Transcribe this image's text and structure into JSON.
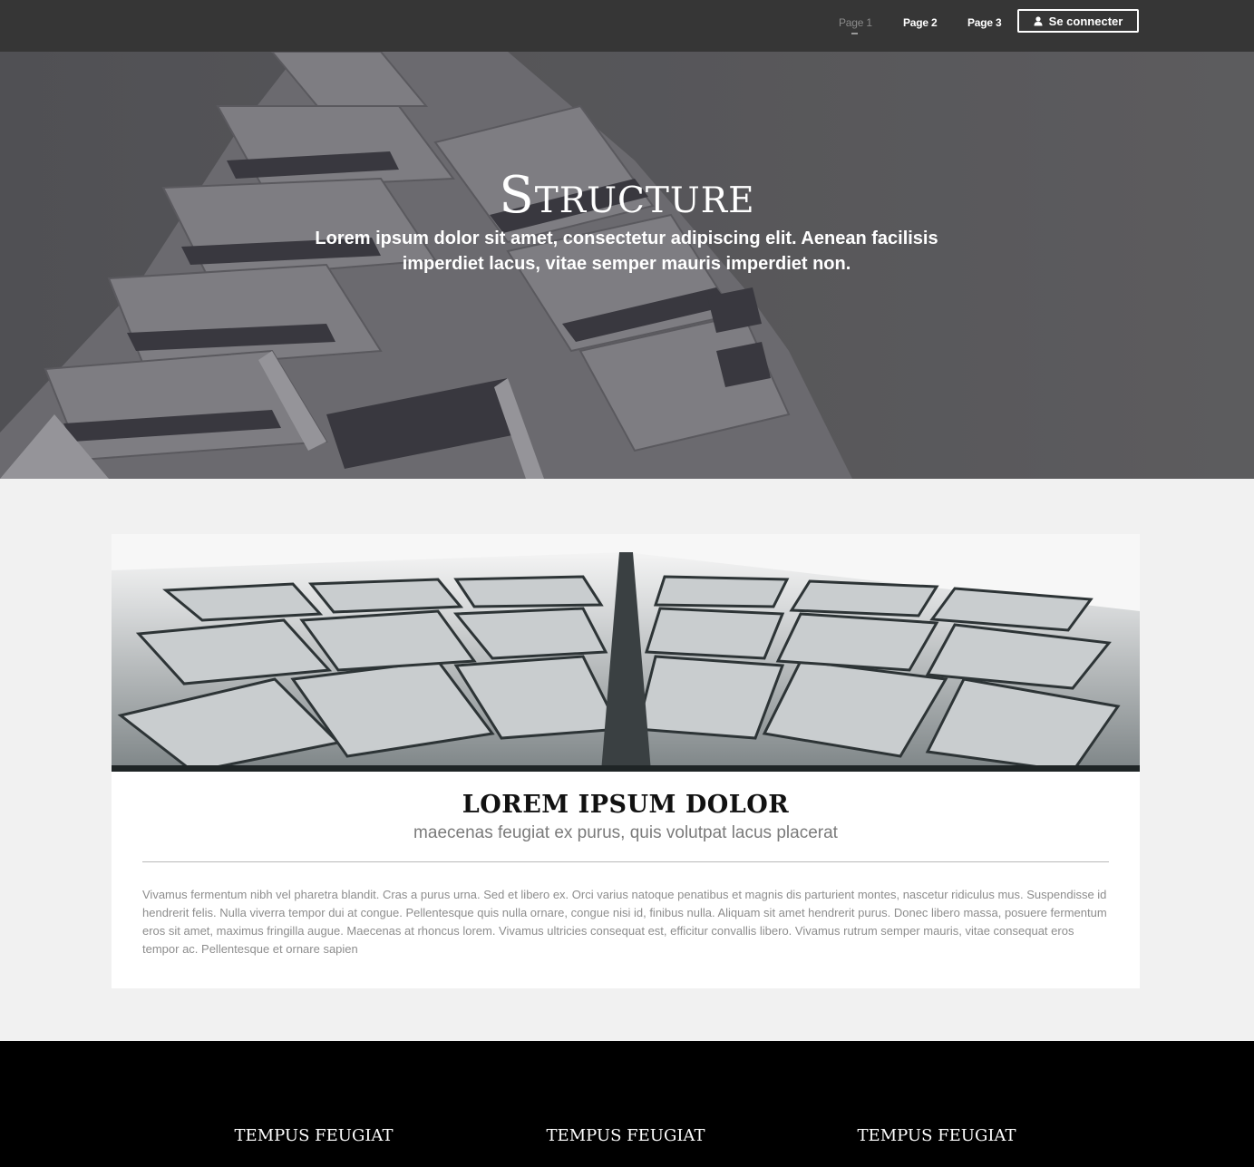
{
  "nav": {
    "links": [
      "Page 1",
      "Page 2",
      "Page 3"
    ],
    "active_index": 0,
    "login_label": "Se connecter",
    "login_icon": "user-icon"
  },
  "hero": {
    "title": "Structure",
    "subtitle": "Lorem ipsum dolor sit amet, consectetur adipiscing elit. Aenean facilisis imperdiet lacus, vitae semper mauris imperdiet non."
  },
  "card": {
    "title": "LOREM IPSUM DOLOR",
    "subtitle": "maecenas feugiat ex purus, quis volutpat lacus placerat",
    "body": "Vivamus fermentum nibh vel pharetra blandit. Cras a purus urna. Sed et libero ex. Orci varius natoque penatibus et magnis dis parturient montes, nascetur ridiculus mus. Suspendisse id hendrerit felis. Nulla viverra tempor dui at congue. Pellentesque quis nulla ornare, congue nisi id, finibus nulla. Aliquam sit amet hendrerit purus. Donec libero massa, posuere fermentum eros sit amet, maximus fringilla augue. Maecenas at rhoncus lorem. Vivamus ultricies consequat est, efficitur convallis libero. Vivamus rutrum semper mauris, vitae consequat eros tempor ac. Pellentesque et ornare sapien"
  },
  "footer": {
    "headings": [
      "TEMPUS FEUGIAT",
      "TEMPUS FEUGIAT",
      "TEMPUS FEUGIAT"
    ]
  },
  "colors": {
    "navbar": "#363636",
    "page_background": "#f1f1f1",
    "footer": "#000000",
    "card": "#ffffff"
  }
}
